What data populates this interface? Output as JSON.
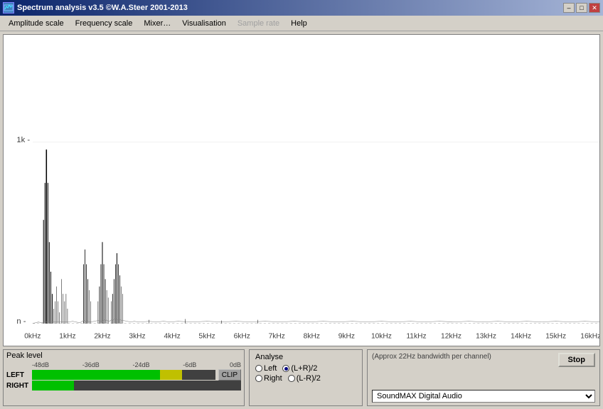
{
  "title": {
    "icon_label": "▤",
    "text": "Spectrum analysis v3.5  ©W.A.Steer  2001-2013"
  },
  "window_controls": {
    "minimize": "–",
    "maximize": "□",
    "close": "✕"
  },
  "menu": {
    "items": [
      {
        "label": "Amplitude scale",
        "disabled": false
      },
      {
        "label": "Frequency scale",
        "disabled": false
      },
      {
        "label": "Mixer…",
        "disabled": false
      },
      {
        "label": "Visualisation",
        "disabled": false
      },
      {
        "label": "Sample rate",
        "disabled": true
      },
      {
        "label": "Help",
        "disabled": false
      }
    ]
  },
  "spectrum": {
    "label": "Spectrum analysis",
    "x_labels": [
      "0kHz",
      "1kHz",
      "2kHz",
      "3kHz",
      "4kHz",
      "5kHz",
      "6kHz",
      "7kHz",
      "8kHz",
      "9kHz",
      "10kHz",
      "11kHz",
      "12kHz",
      "13kHz",
      "14kHz",
      "15kHz",
      "16kHz"
    ],
    "y_labels": [
      "1k -",
      "n -"
    ]
  },
  "peak_level": {
    "title": "Peak level",
    "channels": [
      {
        "label": "LEFT",
        "green_pct": 65,
        "yellow_pct": 10,
        "red_pct": 0
      },
      {
        "label": "RIGHT",
        "green_pct": 20,
        "yellow_pct": 0,
        "red_pct": 0
      }
    ],
    "db_labels": [
      "-48dB",
      "-36dB",
      "-24dB",
      "-6dB",
      "0dB"
    ],
    "clip_label": "CLIP"
  },
  "analyse": {
    "title": "Analyse",
    "options": [
      {
        "label": "Left",
        "checked": false
      },
      {
        "label": "(L+R)/2",
        "checked": true
      },
      {
        "label": "Right",
        "checked": false
      },
      {
        "label": "(L-R)/2",
        "checked": false
      }
    ]
  },
  "device": {
    "note": "(Approx 22Hz bandwidth per channel)",
    "stop_label": "Stop",
    "device_name": "SoundMAX Digital Audio"
  }
}
